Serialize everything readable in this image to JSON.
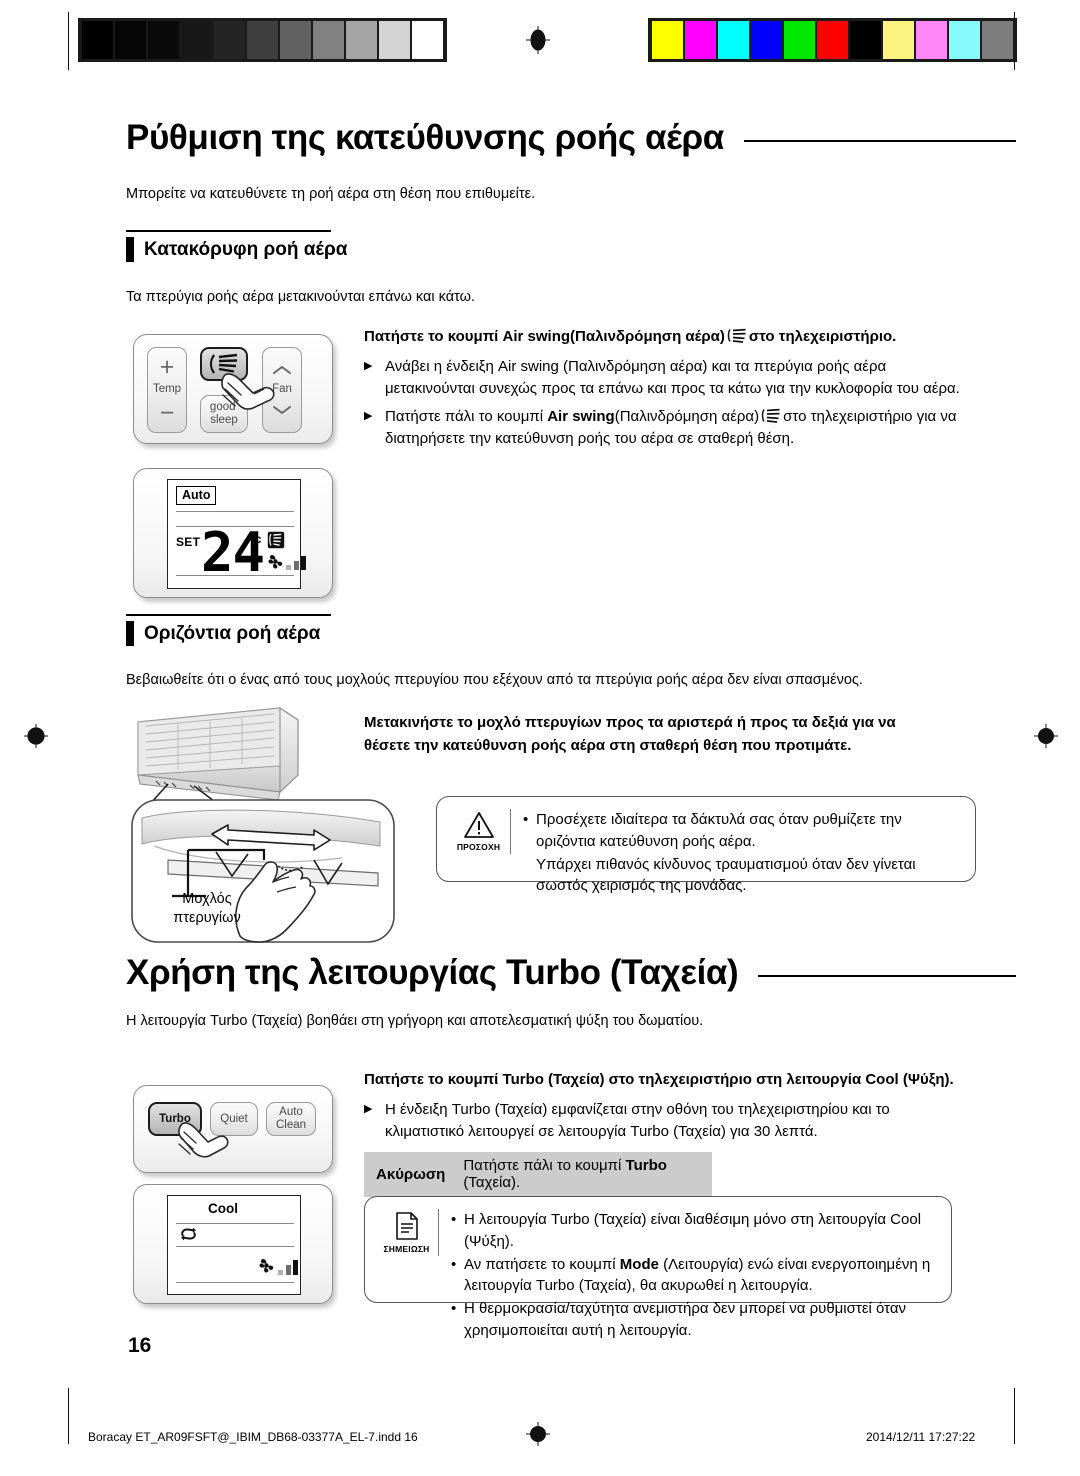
{
  "calibration": {
    "gray_swatches": [
      "#000000",
      "#050505",
      "#0a0a0a",
      "#171717",
      "#242424",
      "#3e3e3e",
      "#616161",
      "#818181",
      "#a5a5a5",
      "#d4d4d4",
      "#ffffff"
    ],
    "color_swatches": [
      "#ffff00",
      "#ff00ff",
      "#00ffff",
      "#0000ff",
      "#00e800",
      "#fc0000",
      "#000000",
      "#fdf380",
      "#ff87f7",
      "#86fbfb",
      "#7d7d7d"
    ]
  },
  "section1": {
    "title": "Ρύθμιση της κατεύθυνσης ροής αέρα",
    "lead": "Μπορείτε να κατευθύνετε τη ροή αέρα στη θέση που επιθυμείτε.",
    "sub1": {
      "heading": "Κατακόρυφη ροή αέρα",
      "lead": "Τα πτερύγια ροής αέρα μετακινούνται επάνω και κάτω.",
      "instruction_a": "Πατήστε το κουμπί Air swing(Παλινδρόμηση αέρα)",
      "instruction_b": "στο τηλεχειριστήριο.",
      "bullets": [
        {
          "parts": [
            {
              "text": "Ανάβει η ένδειξη Air swing (Παλινδρόμηση αέρα) και τα πτερύγια ροής αέρα μετακινούνται συνεχώς προς τα επάνω και προς τα κάτω για την κυκλοφορία του αέρα.",
              "bold": false
            }
          ]
        },
        {
          "parts": [
            {
              "text": "Πατήστε πάλι το κουμπί ",
              "bold": false
            },
            {
              "text": "Air swing",
              "bold": true
            },
            {
              "text": "(Παλινδρόμηση αέρα)",
              "bold": false
            },
            {
              "text": "ICON",
              "bold": false
            },
            {
              "text": " στο τηλεχειριστήριο για να διατηρήσετε την κατεύθυνση ροής του αέρα σε σταθερή θέση.",
              "bold": false
            }
          ]
        }
      ],
      "remote": {
        "temp_label": "Temp",
        "plus": "+",
        "minus": "−",
        "swing_button": "air-swing",
        "good_sleep_l1": "good’",
        "good_sleep_l2": "sleep",
        "fan_label": "Fan"
      },
      "lcd": {
        "mode": "Auto",
        "set_label": "SET",
        "temperature": "24",
        "unit": "°c",
        "swing_icon": "air-swing-indicator",
        "fan_icon": "fan-indicator",
        "fan_bars": 3
      }
    },
    "sub2": {
      "heading": "Οριζόντια ροή αέρα",
      "lead": "Βεβαιωθείτε ότι ο ένας από τους μοχλούς πτερυγίου που εξέχουν από τα πτερύγια ροής αέρα δεν είναι σπασμένος.",
      "instruction": "Μετακινήστε το μοχλό πτερυγίων προς τα αριστερά ή προς τα δεξιά για να θέσετε την κατεύθυνση ροής αέρα στη σταθερή θέση που προτιμάτε.",
      "lever_label_l1": "Μοχλός",
      "lever_label_l2": "πτερυγίων",
      "caution": {
        "icon_caption": "ΠΡΟΣΟΧΗ",
        "lines": [
          "Προσέχετε ιδιαίτερα τα δάκτυλά σας όταν ρυθμίζετε την οριζόντια κατεύθυνση ροής αέρα.",
          "Υπάρχει πιθανός κίνδυνος τραυματισμού όταν δεν γίνεται σωστός χειρισμός της μονάδας."
        ]
      }
    }
  },
  "section2": {
    "title": "Χρήση της λειτουργίας Turbo (Ταχεία)",
    "lead": "Η λειτουργία Turbo (Ταχεία) βοηθάει στη γρήγορη και αποτελεσματική ψύξη του δωματίου.",
    "instruction": "Πατήστε το κουμπί Turbo (Ταχεία) στο τηλεχειριστήριο στη λειτουργία Cool (Ψύξη).",
    "bullets": [
      {
        "text": "Η ένδειξη Turbo (Ταχεία) εμφανίζεται στην οθόνη του τηλεχειριστηρίου και το κλιματιστικό λειτουργεί σε λειτουργία Turbo (Ταχεία) για 30 λεπτά."
      }
    ],
    "cancel": {
      "label": "Ακύρωση",
      "pre": "Πατήστε πάλι το κουμπί ",
      "bold": "Turbo",
      "post": " (Ταχεία)."
    },
    "remote": {
      "turbo": "Turbo",
      "quiet": "Quiet",
      "auto_l1": "Auto",
      "auto_l2": "Clean"
    },
    "lcd": {
      "mode": "Cool",
      "turbo_icon": "turbo-indicator",
      "fan_icon": "fan-indicator",
      "fan_bars": 3
    },
    "note": {
      "icon_caption": "ΣΗΜΕΙΩΣΗ",
      "bullets": [
        {
          "parts": [
            {
              "text": "Η λειτουργία Turbo (Ταχεία) είναι διαθέσιμη μόνο στη λειτουργία Cool (Ψύξη).",
              "bold": false
            }
          ]
        },
        {
          "parts": [
            {
              "text": "Αν πατήσετε το κουμπί ",
              "bold": false
            },
            {
              "text": "Mode",
              "bold": true
            },
            {
              "text": " (Λειτουργία) ενώ είναι ενεργοποιημένη η λειτουργία Turbo (Ταχεία), θα ακυρωθεί η λειτουργία.",
              "bold": false
            }
          ]
        },
        {
          "parts": [
            {
              "text": "Η θερμοκρασία/ταχύτητα ανεμιστήρα δεν μπορεί να ρυθμιστεί όταν χρησιμοποιείται αυτή η λειτουργία.",
              "bold": false
            }
          ]
        }
      ]
    }
  },
  "footer": {
    "page_number": "16",
    "file_name": "Boracay ET_AR09FSFT@_IBIM_DB68-03377A_EL-7.indd   16",
    "timestamp": "2014/12/11   17:27:22"
  }
}
